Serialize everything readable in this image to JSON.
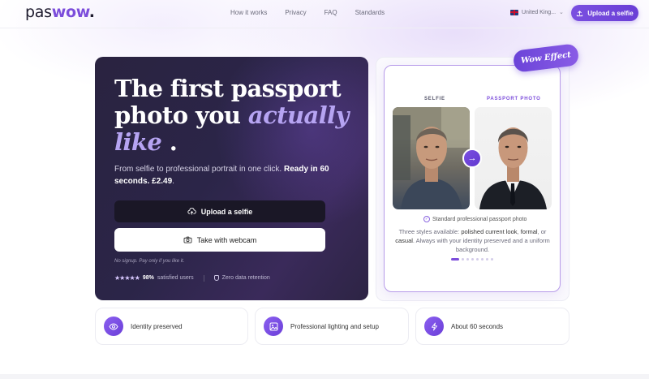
{
  "nav": {
    "logo_part1": "pas",
    "logo_part2": "wow",
    "logo_dot": ".",
    "links": [
      "How it works",
      "Privacy",
      "FAQ",
      "Standards"
    ],
    "language": "United King...",
    "upload_label": "Upload a selfie"
  },
  "hero": {
    "title_line1": "The first passport",
    "title_line2_a": "photo you",
    "title_line2_b": "actually",
    "title_line3_a": "like",
    "title_line3_b": ".",
    "subtitle_a": "From selfie to professional portrait in one click.",
    "subtitle_b": "Ready in 60 seconds. £2.49",
    "subtitle_c": ".",
    "upload_button": "Upload a selfie",
    "webcam_button": "Take with webcam",
    "fine_print": "No signup. Pay only if you like it.",
    "stars": "★★★★★",
    "satisfied_percent": "98%",
    "satisfied_label": "satisfied users",
    "retention": "Zero data retention"
  },
  "compare": {
    "badge": "Wow Effect",
    "selfie_label": "SELFIE",
    "passport_label": "PASSPORT PHOTO",
    "standard": "Standard professional passport photo",
    "desc_a": "Three styles available:",
    "desc_s1": "polished current look",
    "desc_sep1": ",",
    "desc_s2": "formal",
    "desc_sep2": ", or",
    "desc_s3": "casual",
    "desc_b": ". Always with your identity preserved and a uniform background.",
    "carousel_total": 8,
    "carousel_active": 1
  },
  "features": [
    {
      "label": "Identity preserved",
      "icon": "eye-icon"
    },
    {
      "label": "Professional lighting and setup",
      "icon": "image-icon"
    },
    {
      "label": "About 60 seconds",
      "icon": "bolt-icon"
    }
  ],
  "colors": {
    "accent": "#7c4ddb",
    "hero_bg": "#2a2340",
    "accent_light": "#b6a4f2"
  }
}
